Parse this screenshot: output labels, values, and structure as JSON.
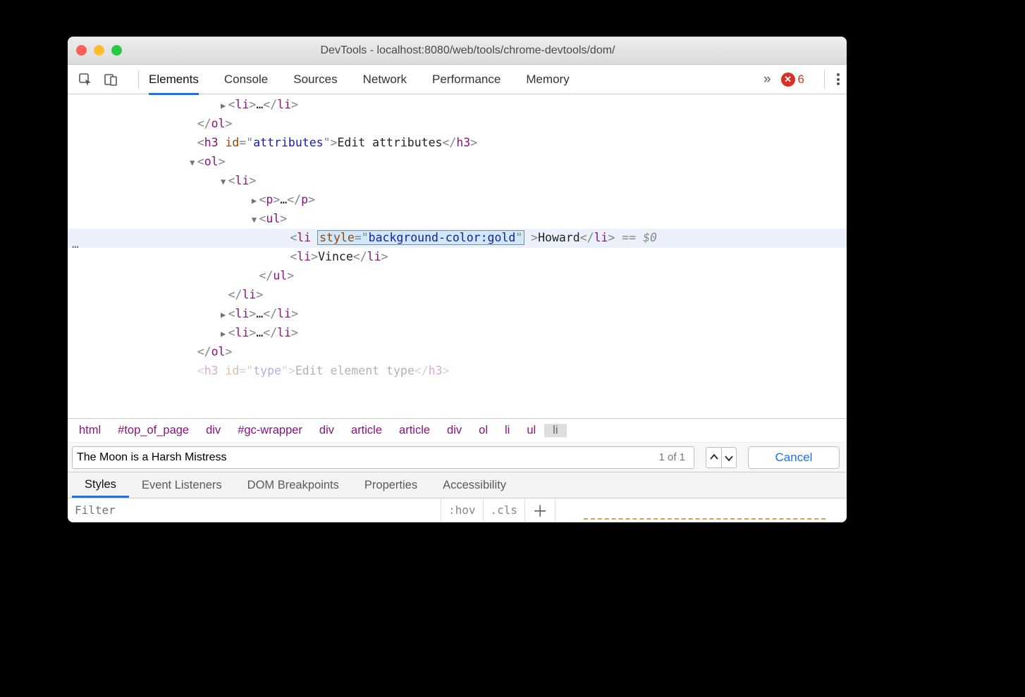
{
  "window_title": "DevTools - localhost:8080/web/tools/chrome-devtools/dom/",
  "toolbar": {
    "tabs": [
      "Elements",
      "Console",
      "Sources",
      "Network",
      "Performance",
      "Memory"
    ],
    "active_tab": "Elements",
    "more_glyph": "»",
    "error_count": "6"
  },
  "dom": {
    "rows": [
      {
        "indent": 3,
        "triangle": "right",
        "html": "<li>…</li>"
      },
      {
        "indent": 2,
        "html": "</ol>"
      },
      {
        "indent": 2,
        "h3_id": "attributes",
        "h3_text": "Edit attributes"
      },
      {
        "indent": 2,
        "triangle": "down",
        "html": "<ol>"
      },
      {
        "indent": 3,
        "triangle": "down",
        "html": "<li>"
      },
      {
        "indent": 4,
        "triangle": "right",
        "html": "<p>…</p>"
      },
      {
        "indent": 4,
        "triangle": "down",
        "html": "<ul>"
      },
      {
        "indent": 5,
        "highlight": true,
        "li_attr": "style=\"background-color:gold\"",
        "li_text": "Howard",
        "suffix": " == $0"
      },
      {
        "indent": 5,
        "html": "<li>Vince</li>"
      },
      {
        "indent": 4,
        "html": "</ul>"
      },
      {
        "indent": 3,
        "html": "</li>"
      },
      {
        "indent": 3,
        "triangle": "right",
        "html": "<li>…</li>"
      },
      {
        "indent": 3,
        "triangle": "right",
        "html": "<li>…</li>"
      },
      {
        "indent": 2,
        "html": "</ol>"
      },
      {
        "indent": 2,
        "cutoff": true,
        "h3_id": "type",
        "h3_text": "Edit element type"
      }
    ],
    "ellipsis": "…"
  },
  "breadcrumb": [
    "html",
    "#top_of_page",
    "div",
    "#gc-wrapper",
    "div",
    "article",
    "article",
    "div",
    "ol",
    "li",
    "ul",
    "li"
  ],
  "breadcrumb_selected_index": 11,
  "search": {
    "value": "The Moon is a Harsh Mistress",
    "match_text": "1 of 1",
    "cancel_label": "Cancel"
  },
  "subtabs": [
    "Styles",
    "Event Listeners",
    "DOM Breakpoints",
    "Properties",
    "Accessibility"
  ],
  "subtab_active": "Styles",
  "styles": {
    "filter_placeholder": "Filter",
    "hov": ":hov",
    "cls": ".cls"
  }
}
